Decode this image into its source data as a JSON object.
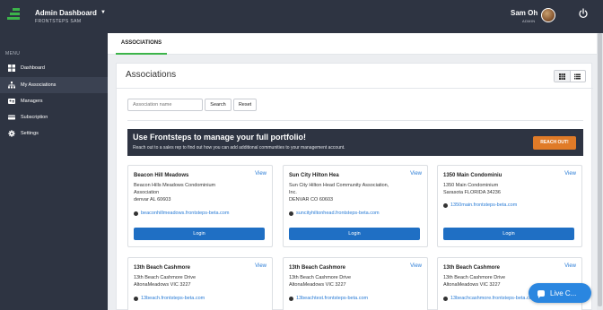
{
  "header": {
    "title": "Admin Dashboard",
    "subtitle": "FRONTSTEPS SAM",
    "user_name": "Sam Oh",
    "user_role": "ADMIN"
  },
  "sidebar": {
    "menu_label": "MENU",
    "items": [
      {
        "label": "Dashboard",
        "icon": "dashboard-icon",
        "active": false
      },
      {
        "label": "My Associations",
        "icon": "sitemap-icon",
        "active": true
      },
      {
        "label": "Managers",
        "icon": "id-card-icon",
        "active": false
      },
      {
        "label": "Subscription",
        "icon": "credit-card-icon",
        "active": false
      },
      {
        "label": "Settings",
        "icon": "gear-icon",
        "active": false
      }
    ]
  },
  "tabs": [
    {
      "label": "ASSOCIATIONS",
      "active": true
    }
  ],
  "main": {
    "title": "Associations",
    "search": {
      "placeholder": "Association name",
      "value": ""
    },
    "search_button": "Search",
    "reset_button": "Reset"
  },
  "banner": {
    "title": "Use Frontsteps to manage your full portfolio!",
    "subtitle": "Reach out to a sales rep to find out how you can add additional communities to your management account.",
    "button": "REACH OUT!"
  },
  "cards": [
    {
      "name": "Beacon Hill Meadows",
      "view": "View",
      "address": [
        "Beacon Hills Meadows Condominium",
        "Association",
        "denvar AL 60603"
      ],
      "link": "beaconhillmeadows.frontsteps-beta.com",
      "login": "Login"
    },
    {
      "name": "Sun City Hilton Hea",
      "view": "View",
      "address": [
        "Sun City Hilton Head Community Association,",
        "Inc.",
        "DENVAR CO 60603"
      ],
      "link": "suncityhiltonhead.frontsteps-beta.com",
      "login": "Login"
    },
    {
      "name": "1350 Main Condominiu",
      "view": "View",
      "address": [
        "1350 Main Condominium",
        "Sarasota FLORIDA 34236"
      ],
      "link": "1350main.frontsteps-beta.com",
      "login": "Login"
    },
    {
      "name": "13th Beach Cashmore",
      "view": "View",
      "address": [
        "13th Beach Cashmore Drive",
        "AltonaMeadows VIC 3227"
      ],
      "link": "13beach.frontsteps-beta.com",
      "login": ""
    },
    {
      "name": "13th Beach Cashmore",
      "view": "View",
      "address": [
        "13th Beach Cashmore Drive",
        "AltonaMeadows VIC 3227"
      ],
      "link": "13beachtest.frontsteps-beta.com",
      "login": ""
    },
    {
      "name": "13th Beach Cashmore",
      "view": "View",
      "address": [
        "13th Beach Cashmore Drive",
        "AltonaMeadows VIC 3227"
      ],
      "link": "13beachcashmore.frontsteps-beta.com",
      "login": ""
    }
  ],
  "chat": {
    "label": "Live C..."
  },
  "colors": {
    "nav_bg": "#2e3442",
    "accent_green": "#3cb44a",
    "reach_orange": "#e07b28",
    "login_blue": "#1f6fc4",
    "link_blue": "#2a7cd6"
  }
}
